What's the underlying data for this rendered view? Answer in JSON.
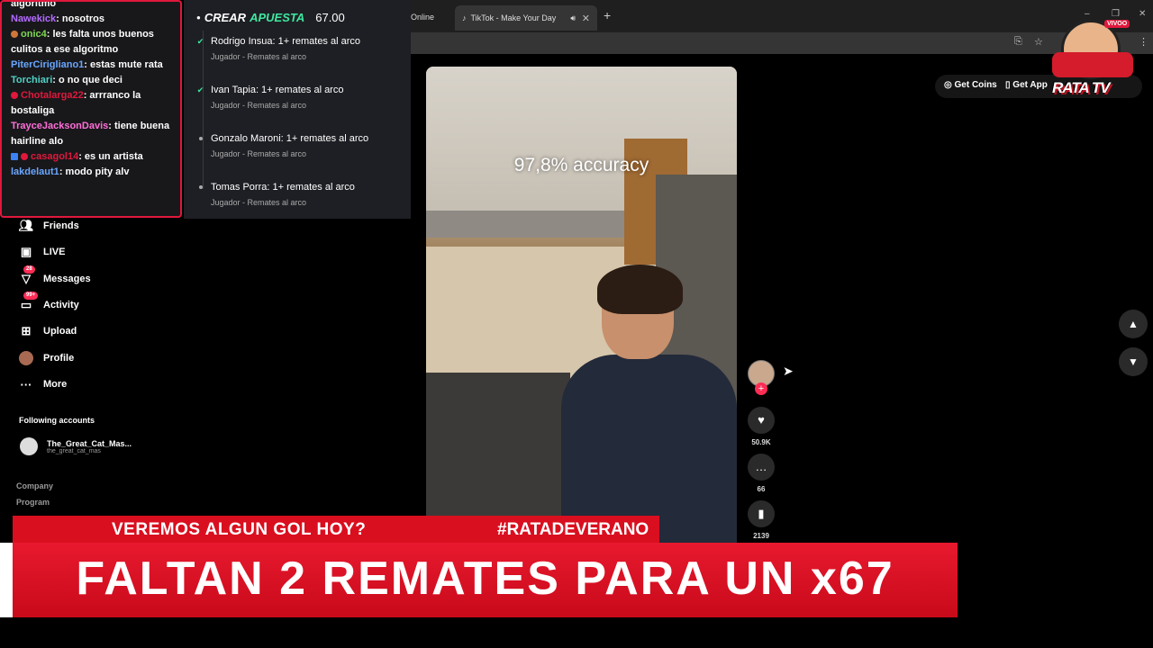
{
  "browser": {
    "tabs": [
      {
        "label": "Online",
        "active": false
      },
      {
        "label": "TikTok - Make Your Day",
        "active": true
      }
    ]
  },
  "chat": {
    "messages": [
      {
        "user": "",
        "text": "algoritmo",
        "color": "#ffffff"
      },
      {
        "user": "Nawekick",
        "text": ": nosotros",
        "color": "#b36bff"
      },
      {
        "user": "onic4",
        "text": ": les falta unos buenos culitos a ese algoritmo",
        "color": "#7fd84f"
      },
      {
        "user": "PiterCirigliano1",
        "text": ": estas mute rata",
        "color": "#6aa7ff"
      },
      {
        "user": "Torchiari",
        "text": ": o no que deci",
        "color": "#4fd1c5"
      },
      {
        "user": "Chotalarga22",
        "text": ": arrranco la bostaliga",
        "color": "#e0183c"
      },
      {
        "user": "TrayceJacksonDavis",
        "text": ": tiene buena hairline alo",
        "color": "#ff6fd8"
      },
      {
        "user": "casagol14",
        "text": ": es un artista",
        "color": "#e0183c"
      },
      {
        "user": "lakdelaut1",
        "text": ": modo pity alv",
        "color": "#6aa7ff"
      }
    ]
  },
  "bet": {
    "crear": "CREAR",
    "apuesta": "APUESTA",
    "odds": "67.00",
    "items": [
      {
        "title": "Rodrigo Insua: 1+ remates al arco",
        "sub": "Jugador - Remates al arco",
        "checked": true
      },
      {
        "title": "Ivan Tapia: 1+ remates al arco",
        "sub": "Jugador - Remates al arco",
        "checked": true
      },
      {
        "title": "Gonzalo Maroni: 1+ remates al arco",
        "sub": "Jugador - Remates al arco",
        "checked": false
      },
      {
        "title": "Tomas Porra: 1+ remates al arco",
        "sub": "Jugador - Remates al arco",
        "checked": false
      }
    ]
  },
  "sidebar": {
    "items": [
      {
        "label": "Friends",
        "icon": "friends-icon"
      },
      {
        "label": "LIVE",
        "icon": "live-icon"
      },
      {
        "label": "Messages",
        "icon": "messages-icon",
        "badge": "28"
      },
      {
        "label": "Activity",
        "icon": "activity-icon",
        "badge": "99+"
      },
      {
        "label": "Upload",
        "icon": "upload-icon"
      },
      {
        "label": "Profile",
        "icon": "profile-icon"
      },
      {
        "label": "More",
        "icon": "more-icon"
      }
    ],
    "following_title": "Following accounts",
    "following": [
      {
        "name": "The_Great_Cat_Mas...",
        "handle": "the_great_cat_mas"
      }
    ],
    "footer": [
      "Company",
      "Program"
    ]
  },
  "video": {
    "overlay_text": "97,8% accuracy"
  },
  "actions": {
    "likes": "50.9K",
    "comments": "66",
    "saves": "2139"
  },
  "top_right": {
    "get_coins": "Get Coins",
    "get_app": "Get App"
  },
  "logo": {
    "brand": "RATA TV",
    "live": "VIVOO"
  },
  "banners": {
    "ticker_left": "VEREMOS ALGUN GOL HOY?",
    "ticker_right": "#RATADEVERANO",
    "main": "FALTAN 2 REMATES PARA UN x67"
  },
  "colors": {
    "accent_red": "#e0183c",
    "bet_green": "#3ee8a0",
    "tiktok_pink": "#fe2c55"
  }
}
